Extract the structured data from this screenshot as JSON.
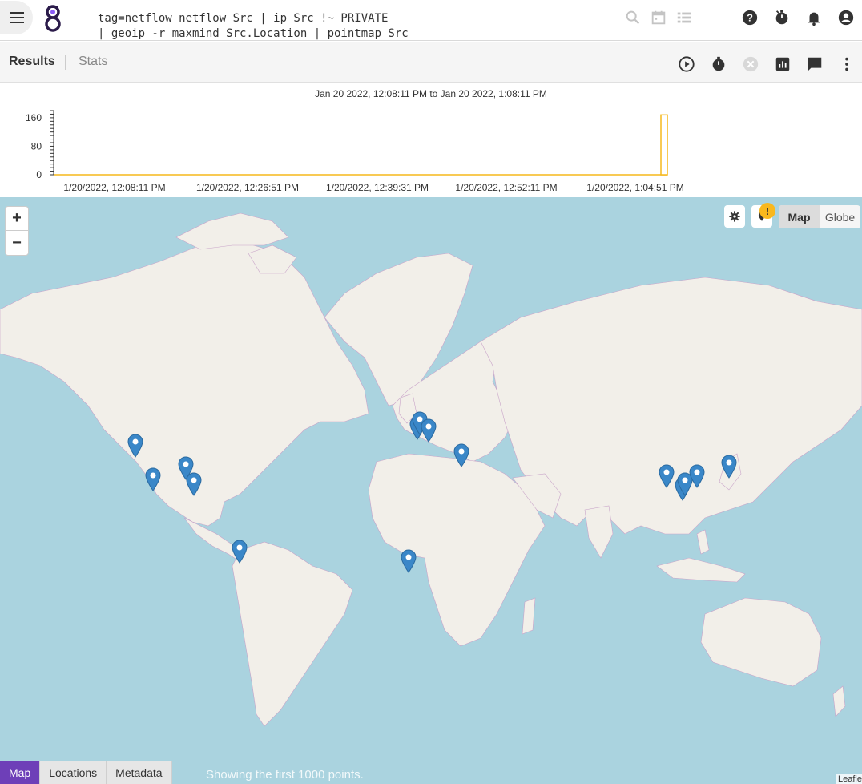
{
  "query": {
    "line1": "tag=netflow netflow Src | ip Src !~ PRIVATE",
    "line2": "| geoip -r maxmind Src.Location | pointmap Src"
  },
  "topbar_icons": [
    "search-icon",
    "calendar-icon",
    "list-icon",
    "help-icon",
    "timer-icon",
    "bell-icon",
    "account-icon"
  ],
  "tabs": {
    "results": "Results",
    "stats": "Stats"
  },
  "toolbar_icons": [
    "play-icon",
    "stopwatch-icon",
    "cancel-icon",
    "chart-icon",
    "comment-icon",
    "more-icon"
  ],
  "chart_data": {
    "type": "bar",
    "range_label": "Jan 20 2022, 12:08:11 PM to Jan 20 2022, 1:08:11 PM",
    "y_ticks": [
      "160",
      "80",
      "0"
    ],
    "ylim": [
      0,
      180
    ],
    "x_ticks": [
      "1/20/2022, 12:08:11 PM",
      "1/20/2022, 12:26:51 PM",
      "1/20/2022, 12:39:31 PM",
      "1/20/2022, 12:52:11 PM",
      "1/20/2022, 1:04:51 PM"
    ],
    "series": [
      {
        "values": [
          {
            "x": "1/20/2022, 1:07:11 PM",
            "y": 168
          }
        ]
      }
    ],
    "bar_color": "#f5b81c"
  },
  "map": {
    "zoom_in": "+",
    "zoom_out": "−",
    "warning_badge": "!",
    "view_toggle": {
      "map": "Map",
      "globe": "Globe",
      "active": "Map"
    },
    "marker_color": "#3a87c8",
    "attribution": "Leaflet"
  },
  "bottom_tabs": {
    "map": "Map",
    "locations": "Locations",
    "metadata": "Metadata",
    "active": "Map"
  },
  "status": "Showing the first 1000 points."
}
